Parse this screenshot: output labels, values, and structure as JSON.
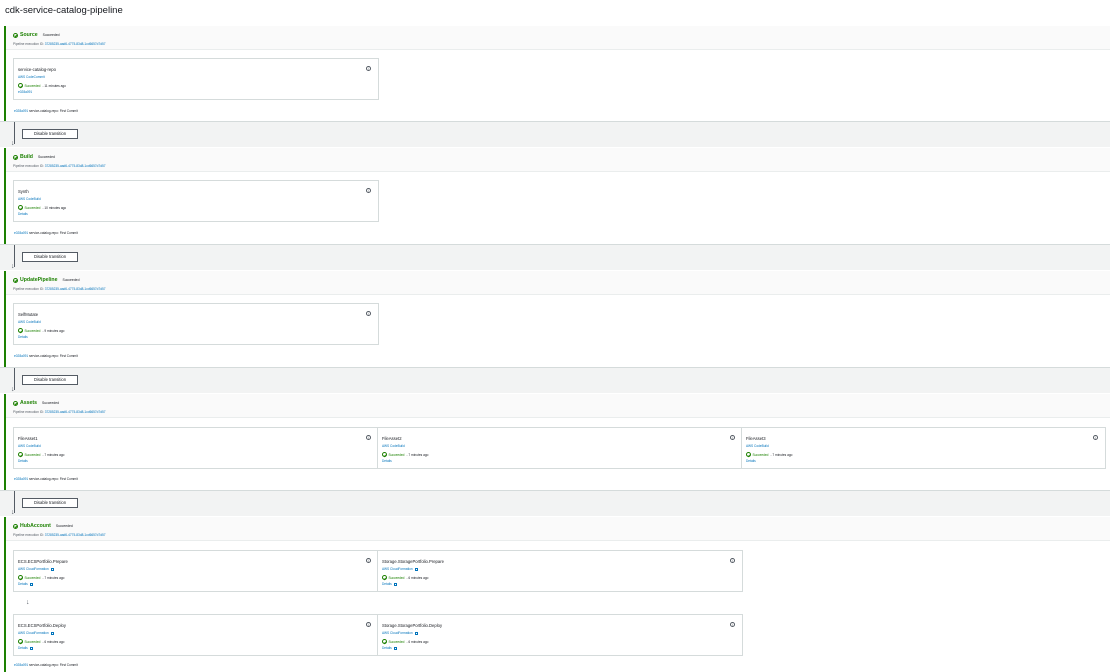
{
  "page": {
    "title": "cdk-service-catalog-pipeline"
  },
  "transition_button": "Disable transition",
  "stages": [
    {
      "name": "Source",
      "status": "Succeeded",
      "execution": {
        "label": "Pipeline execution ID:",
        "id": "37285235-aad6-4775-83d8-1cd6657d7d57"
      },
      "actions": [
        {
          "name": "service-catalog-repo",
          "provider": "AWS CodeCommit",
          "status": "Succeeded",
          "time": "- 11 minutes ago",
          "detail": "e028a091"
        }
      ],
      "commit": {
        "id": "e028a091",
        "text": "service-catalog-repo: First Commit"
      }
    },
    {
      "name": "Build",
      "status": "Succeeded",
      "execution": {
        "label": "Pipeline execution ID:",
        "id": "37285235-aad6-4775-83d8-1cd6657d7d57"
      },
      "actions": [
        {
          "name": "Synth",
          "provider": "AWS CodeBuild",
          "status": "Succeeded",
          "time": "- 10 minutes ago",
          "detail": "Details"
        }
      ],
      "commit": {
        "id": "e028a091",
        "text": "service-catalog-repo: First Commit"
      }
    },
    {
      "name": "UpdatePipeline",
      "status": "Succeeded",
      "execution": {
        "label": "Pipeline execution ID:",
        "id": "37285235-aad6-4775-83d8-1cd6657d7d57"
      },
      "actions": [
        {
          "name": "SelfMutate",
          "provider": "AWS CodeBuild",
          "status": "Succeeded",
          "time": "- 9 minutes ago",
          "detail": "Details"
        }
      ],
      "commit": {
        "id": "e028a091",
        "text": "service-catalog-repo: First Commit"
      }
    },
    {
      "name": "Assets",
      "status": "Succeeded",
      "execution": {
        "label": "Pipeline execution ID:",
        "id": "37285235-aad6-4775-83d8-1cd6657d7d57"
      },
      "actions": [
        {
          "name": "FileAsset1",
          "provider": "AWS CodeBuild",
          "status": "Succeeded",
          "time": "- 7 minutes ago",
          "detail": "Details"
        },
        {
          "name": "FileAsset2",
          "provider": "AWS CodeBuild",
          "status": "Succeeded",
          "time": "- 7 minutes ago",
          "detail": "Details"
        },
        {
          "name": "FileAsset3",
          "provider": "AWS CodeBuild",
          "status": "Succeeded",
          "time": "- 7 minutes ago",
          "detail": "Details"
        }
      ],
      "commit": {
        "id": "e028a091",
        "text": "service-catalog-repo: First Commit"
      }
    },
    {
      "name": "HubAccount",
      "status": "Succeeded",
      "execution": {
        "label": "Pipeline execution ID:",
        "id": "37285235-aad6-4775-83d8-1cd6657d7d57"
      },
      "actions": [
        {
          "name": "ECS.ECSPortfolio.Prepare",
          "provider": "AWS CloudFormation",
          "status": "Succeeded",
          "time": "- 7 minutes ago",
          "detail": "Details"
        },
        {
          "name": "Storage.StoragePortfolio.Prepare",
          "provider": "AWS CloudFormation",
          "status": "Succeeded",
          "time": "- 6 minutes ago",
          "detail": "Details"
        },
        {
          "name": "ECS.ECSPortfolio.Deploy",
          "provider": "AWS CloudFormation",
          "status": "Succeeded",
          "time": "- 6 minutes ago",
          "detail": "Details"
        },
        {
          "name": "Storage.StoragePortfolio.Deploy",
          "provider": "AWS CloudFormation",
          "status": "Succeeded",
          "time": "- 6 minutes ago",
          "detail": "Details"
        }
      ],
      "commit": {
        "id": "e028a091",
        "text": "service-catalog-repo: First Commit"
      }
    }
  ]
}
